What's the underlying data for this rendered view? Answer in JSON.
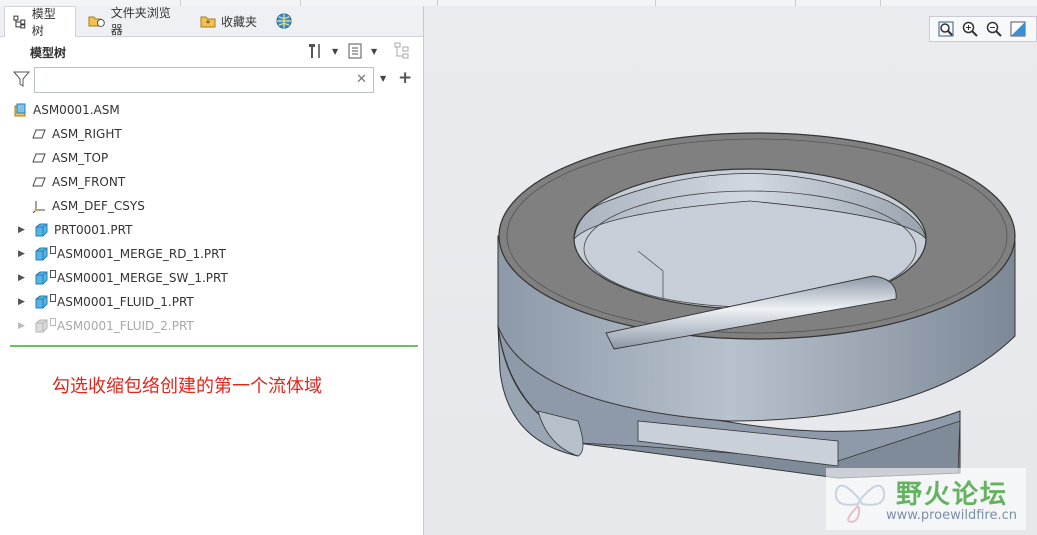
{
  "tabs": [
    {
      "label": "模型树",
      "icon": "model-tree-icon",
      "active": true
    },
    {
      "label": "文件夹浏览器",
      "icon": "folder-browser-icon",
      "active": false
    },
    {
      "label": "收藏夹",
      "icon": "favorites-icon",
      "active": false
    },
    {
      "label": "",
      "icon": "web-browser-icon",
      "active": false
    }
  ],
  "panel": {
    "title": "模型树",
    "search_value": "",
    "search_placeholder": ""
  },
  "tree": [
    {
      "label": "ASM0001.ASM",
      "icon": "assembly-icon",
      "expandable": false,
      "indent": 0,
      "dim": false,
      "mark": false
    },
    {
      "label": "ASM_RIGHT",
      "icon": "datum-plane-icon",
      "expandable": false,
      "indent": 1,
      "dim": false,
      "mark": false
    },
    {
      "label": "ASM_TOP",
      "icon": "datum-plane-icon",
      "expandable": false,
      "indent": 1,
      "dim": false,
      "mark": false
    },
    {
      "label": "ASM_FRONT",
      "icon": "datum-plane-icon",
      "expandable": false,
      "indent": 1,
      "dim": false,
      "mark": false
    },
    {
      "label": "ASM_DEF_CSYS",
      "icon": "csys-icon",
      "expandable": false,
      "indent": 1,
      "dim": false,
      "mark": false
    },
    {
      "label": "PRT0001.PRT",
      "icon": "part-icon",
      "expandable": true,
      "indent": 0,
      "dim": false,
      "mark": false
    },
    {
      "label": "ASM0001_MERGE_RD_1.PRT",
      "icon": "part-icon",
      "expandable": true,
      "indent": 0,
      "dim": false,
      "mark": true
    },
    {
      "label": "ASM0001_MERGE_SW_1.PRT",
      "icon": "part-icon",
      "expandable": true,
      "indent": 0,
      "dim": false,
      "mark": true
    },
    {
      "label": "ASM0001_FLUID_1.PRT",
      "icon": "part-icon",
      "expandable": true,
      "indent": 0,
      "dim": false,
      "mark": true
    },
    {
      "label": "ASM0001_FLUID_2.PRT",
      "icon": "part-icon",
      "expandable": true,
      "indent": 0,
      "dim": true,
      "mark": true
    }
  ],
  "annotation": "勾选收缩包络创建的第一个流体域",
  "viewbar": [
    {
      "icon": "zoom-fit-icon"
    },
    {
      "icon": "zoom-in-icon"
    },
    {
      "icon": "zoom-out-icon"
    },
    {
      "icon": "repaint-icon"
    }
  ],
  "watermark": {
    "title": "野火论坛",
    "url": "www.proewildfire.cn"
  },
  "colors": {
    "accent_green": "#6fc061",
    "annotation_red": "#e2261c",
    "part_blue": "#3aa6d9"
  }
}
